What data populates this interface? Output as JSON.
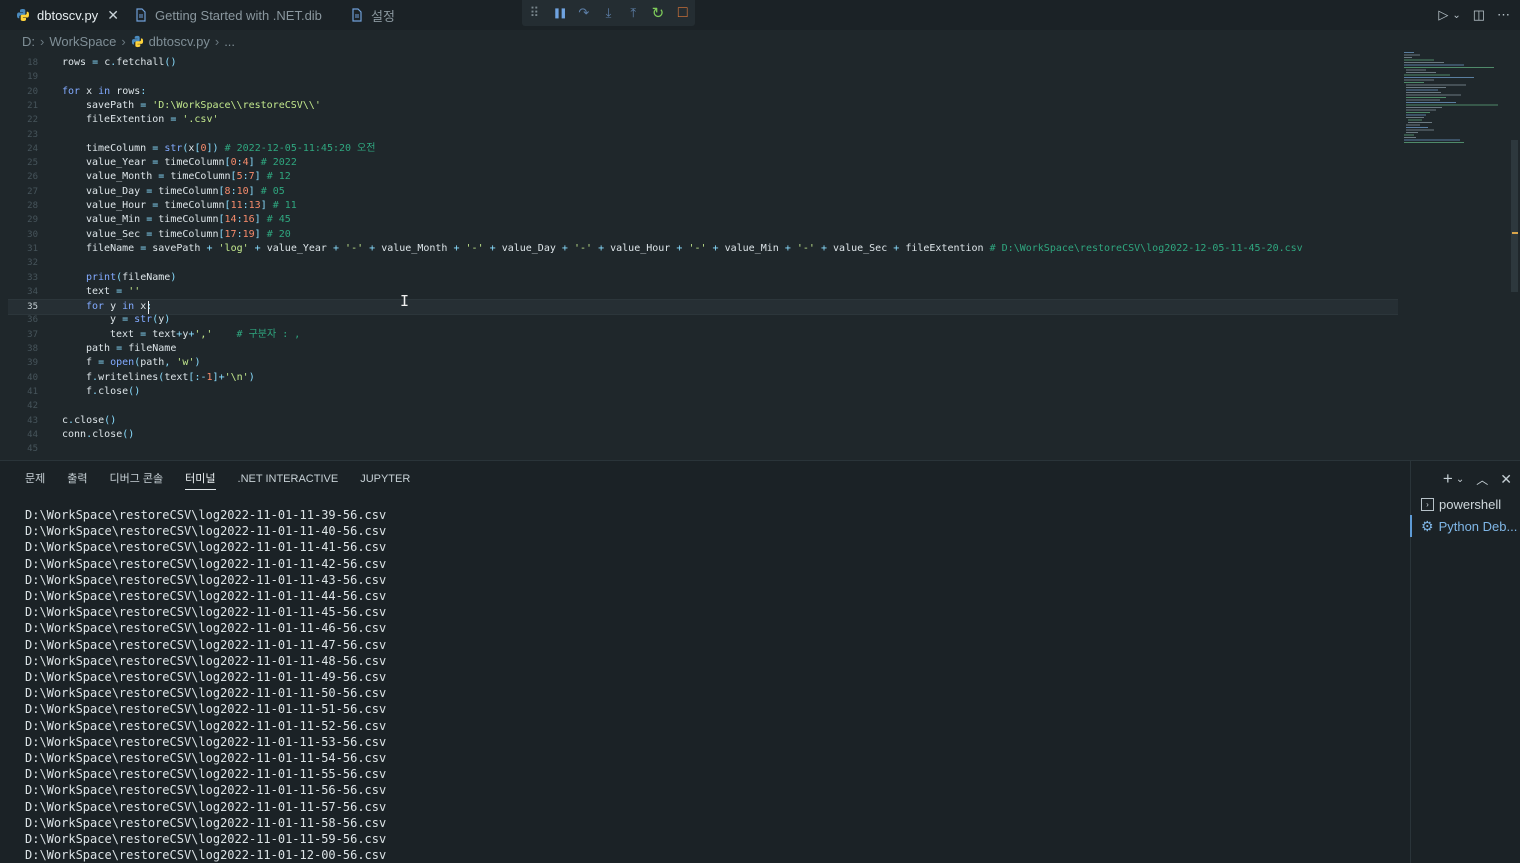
{
  "tabs": [
    {
      "label": "dbtoscv.py",
      "icon": "python-file-icon",
      "active": true
    },
    {
      "label": "Getting Started with .NET.dib",
      "icon": "document-icon",
      "active": false
    },
    {
      "label": "설정",
      "icon": "document-icon",
      "active": false
    }
  ],
  "debug_toolbar": [
    {
      "name": "drag-handle-icon",
      "glyph": "⠿"
    },
    {
      "name": "pause-icon",
      "glyph": "❚❚"
    },
    {
      "name": "step-over-icon",
      "glyph": "↷"
    },
    {
      "name": "step-into-icon",
      "glyph": "⤓"
    },
    {
      "name": "step-out-icon",
      "glyph": "⤒"
    },
    {
      "name": "restart-icon",
      "glyph": "↻"
    },
    {
      "name": "stop-icon",
      "glyph": "□"
    }
  ],
  "breadcrumb": [
    "D:",
    "WorkSpace",
    "dbtoscv.py",
    "..."
  ],
  "editor": {
    "current_line": 35,
    "lines": [
      {
        "n": 18,
        "code": "rows = c.fetchall()",
        "indent": 0
      },
      {
        "n": 19,
        "code": "",
        "indent": 0
      },
      {
        "n": 20,
        "code": "for x in rows:",
        "indent": 0
      },
      {
        "n": 21,
        "code": "savePath = 'D:\\WorkSpace\\\\restoreCSV\\\\'",
        "indent": 1
      },
      {
        "n": 22,
        "code": "fileExtention = '.csv'",
        "indent": 1
      },
      {
        "n": 23,
        "code": "",
        "indent": 0
      },
      {
        "n": 24,
        "code": "timeColumn = str(x[0])",
        "comment": "# 2022-12-05-11:45:20 오전",
        "indent": 1
      },
      {
        "n": 25,
        "code": "value_Year = timeColumn[0:4]",
        "comment": "# 2022",
        "indent": 1
      },
      {
        "n": 26,
        "code": "value_Month = timeColumn[5:7]",
        "comment": "# 12",
        "indent": 1
      },
      {
        "n": 27,
        "code": "value_Day = timeColumn[8:10]",
        "comment": "# 05",
        "indent": 1
      },
      {
        "n": 28,
        "code": "value_Hour = timeColumn[11:13]",
        "comment": "# 11",
        "indent": 1
      },
      {
        "n": 29,
        "code": "value_Min = timeColumn[14:16]",
        "comment": "# 45",
        "indent": 1
      },
      {
        "n": 30,
        "code": "value_Sec = timeColumn[17:19]",
        "comment": "# 20",
        "indent": 1
      },
      {
        "n": 31,
        "code": "fileName = savePath + 'log' + value_Year + '-' + value_Month + '-' + value_Day + '-' + value_Hour + '-' + value_Min + '-' + value_Sec + fileExtention",
        "comment": "# D:\\WorkSpace\\restoreCSV\\log2022-12-05-11-45-20.csv",
        "indent": 1
      },
      {
        "n": 32,
        "code": "",
        "indent": 0
      },
      {
        "n": 33,
        "code": "print(fileName)",
        "indent": 1
      },
      {
        "n": 34,
        "code": "text = ''",
        "indent": 1
      },
      {
        "n": 35,
        "code": "for y in x:",
        "indent": 1
      },
      {
        "n": 36,
        "code": "y = str(y)",
        "indent": 2
      },
      {
        "n": 37,
        "code": "text = text+y+','",
        "comment": "# 구분자 : ,",
        "indent": 2
      },
      {
        "n": 38,
        "code": "path = fileName",
        "indent": 1
      },
      {
        "n": 39,
        "code": "f = open(path, 'w')",
        "indent": 1
      },
      {
        "n": 40,
        "code": "f.writelines(text[:-1]+'\\n')",
        "indent": 1
      },
      {
        "n": 41,
        "code": "f.close()",
        "indent": 1
      },
      {
        "n": 42,
        "code": "",
        "indent": 0
      },
      {
        "n": 43,
        "code": "c.close()",
        "indent": 0
      },
      {
        "n": 44,
        "code": "conn.close()",
        "indent": 0
      },
      {
        "n": 45,
        "code": "",
        "indent": 0
      }
    ]
  },
  "panel": {
    "tabs": [
      {
        "label": "문제",
        "active": false
      },
      {
        "label": "출력",
        "active": false
      },
      {
        "label": "디버그 콘솔",
        "active": false
      },
      {
        "label": "터미널",
        "active": true
      },
      {
        "label": ".NET INTERACTIVE",
        "active": false
      },
      {
        "label": "JUPYTER",
        "active": false
      }
    ],
    "terminal_lines": [
      "D:\\WorkSpace\\restoreCSV\\log2022-11-01-11-39-56.csv",
      "D:\\WorkSpace\\restoreCSV\\log2022-11-01-11-40-56.csv",
      "D:\\WorkSpace\\restoreCSV\\log2022-11-01-11-41-56.csv",
      "D:\\WorkSpace\\restoreCSV\\log2022-11-01-11-42-56.csv",
      "D:\\WorkSpace\\restoreCSV\\log2022-11-01-11-43-56.csv",
      "D:\\WorkSpace\\restoreCSV\\log2022-11-01-11-44-56.csv",
      "D:\\WorkSpace\\restoreCSV\\log2022-11-01-11-45-56.csv",
      "D:\\WorkSpace\\restoreCSV\\log2022-11-01-11-46-56.csv",
      "D:\\WorkSpace\\restoreCSV\\log2022-11-01-11-47-56.csv",
      "D:\\WorkSpace\\restoreCSV\\log2022-11-01-11-48-56.csv",
      "D:\\WorkSpace\\restoreCSV\\log2022-11-01-11-49-56.csv",
      "D:\\WorkSpace\\restoreCSV\\log2022-11-01-11-50-56.csv",
      "D:\\WorkSpace\\restoreCSV\\log2022-11-01-11-51-56.csv",
      "D:\\WorkSpace\\restoreCSV\\log2022-11-01-11-52-56.csv",
      "D:\\WorkSpace\\restoreCSV\\log2022-11-01-11-53-56.csv",
      "D:\\WorkSpace\\restoreCSV\\log2022-11-01-11-54-56.csv",
      "D:\\WorkSpace\\restoreCSV\\log2022-11-01-11-55-56.csv",
      "D:\\WorkSpace\\restoreCSV\\log2022-11-01-11-56-56.csv",
      "D:\\WorkSpace\\restoreCSV\\log2022-11-01-11-57-56.csv",
      "D:\\WorkSpace\\restoreCSV\\log2022-11-01-11-58-56.csv",
      "D:\\WorkSpace\\restoreCSV\\log2022-11-01-11-59-56.csv",
      "D:\\WorkSpace\\restoreCSV\\log2022-11-01-12-00-56.csv"
    ],
    "terminals": [
      {
        "label": "powershell",
        "icon": "terminal-icon",
        "active": false
      },
      {
        "label": "Python Deb...",
        "icon": "debug-gear-icon",
        "active": true
      }
    ]
  },
  "colors": {
    "background": "#1f272b",
    "accent": "#5e9bd6",
    "stop": "#e0793a",
    "restart": "#7ecb5a"
  }
}
